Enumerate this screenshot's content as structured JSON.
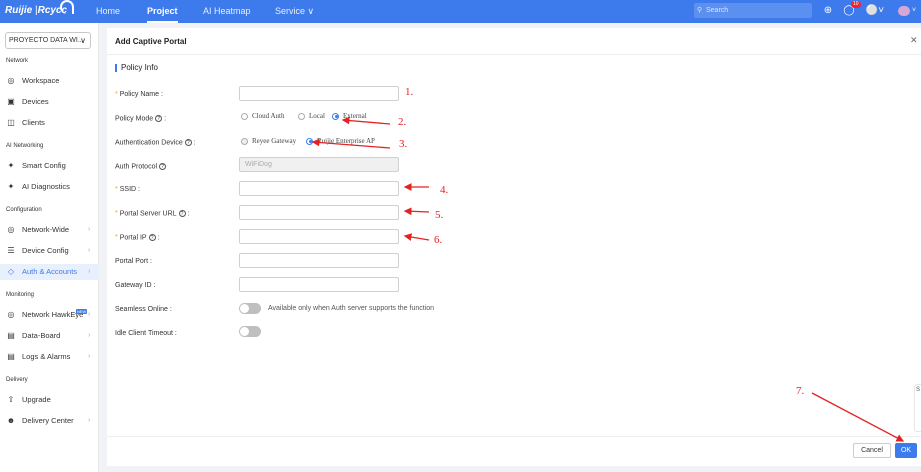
{
  "colors": {
    "accent": "#3d7bec",
    "annotation": "#e52222",
    "required": "#f5a623"
  },
  "topbar": {
    "logo": "Ruijie",
    "logo_sep": "|",
    "logo_brand": "Rcycc",
    "nav": [
      "Home",
      "Project",
      "AI Heatmap",
      "Service ∨"
    ],
    "search_placeholder": "Search",
    "notification_count": "10"
  },
  "sidebar": {
    "project": "PROYECTO DATA WI...",
    "sections": [
      {
        "title": "Network",
        "items": [
          {
            "icon": "workspace-icon",
            "label": "Workspace"
          },
          {
            "icon": "devices-icon",
            "label": "Devices"
          },
          {
            "icon": "clients-icon",
            "label": "Clients"
          }
        ]
      },
      {
        "title": "AI Networking",
        "items": [
          {
            "icon": "smart-config-icon",
            "label": "Smart Config"
          },
          {
            "icon": "ai-diagnostics-icon",
            "label": "AI Diagnostics"
          }
        ]
      },
      {
        "title": "Configuration",
        "items": [
          {
            "icon": "network-wide-icon",
            "label": "Network-Wide"
          },
          {
            "icon": "device-config-icon",
            "label": "Device Config"
          },
          {
            "icon": "auth-accounts-icon",
            "label": "Auth & Accounts"
          }
        ]
      },
      {
        "title": "Monitoring",
        "items": [
          {
            "icon": "network-hawkeye-icon",
            "label": "Network HawkEye",
            "tag": "NEW"
          },
          {
            "icon": "data-board-icon",
            "label": "Data-Board"
          },
          {
            "icon": "logs-alarms-icon",
            "label": "Logs & Alarms"
          }
        ]
      },
      {
        "title": "Delivery",
        "items": [
          {
            "icon": "upgrade-icon",
            "label": "Upgrade"
          },
          {
            "icon": "delivery-center-icon",
            "label": "Delivery Center"
          }
        ]
      }
    ]
  },
  "panel": {
    "title": "Add Captive Portal",
    "section": "Policy Info",
    "fields": {
      "policy_name": "Policy Name :",
      "policy_mode": "Policy Mode",
      "policy_mode_options": [
        "Cloud Auth",
        "Local",
        "External"
      ],
      "auth_device": "Authentication Device",
      "auth_device_options": [
        "Reyee Gateway",
        "Ruijie Enterprise AP"
      ],
      "auth_protocol": "Auth Protocol",
      "auth_protocol_value": "WiFiDog",
      "ssid": "SSID :",
      "portal_server_url": "Portal Server URL",
      "portal_ip": "Portal IP",
      "portal_port": "Portal Port :",
      "gateway_id": "Gateway ID :",
      "seamless_online": "Seamless Online :",
      "seamless_note": "Available only when Auth server supports the function",
      "idle_timeout": "Idle Client Timeout :"
    },
    "cancel": "Cancel",
    "ok": "OK"
  },
  "side_tab": {
    "text": "S"
  },
  "annotations": [
    "1.",
    "2.",
    "3.",
    "4.",
    "5.",
    "6.",
    "7."
  ]
}
